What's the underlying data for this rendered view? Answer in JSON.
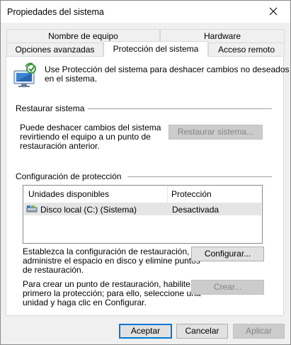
{
  "window": {
    "title": "Propiedades del sistema"
  },
  "tabs": {
    "row1": [
      "Nombre de equipo",
      "Hardware"
    ],
    "row2": [
      "Opciones avanzadas",
      "Protección del sistema",
      "Acceso remoto"
    ],
    "selected": "Protección del sistema"
  },
  "intro": {
    "line1": "Use Protección del sistema para deshacer cambios no deseados",
    "line2": "en el sistema."
  },
  "restore": {
    "group_title": "Restaurar sistema",
    "desc_line1": "Puede deshacer cambios del sistema",
    "desc_line2": "revirtiendo el equipo a un punto de",
    "desc_line3": "restauración anterior.",
    "button_label": "Restaurar sistema..."
  },
  "protection": {
    "group_title": "Configuración de protección",
    "columns": [
      "Unidades disponibles",
      "Protección"
    ],
    "drives": [
      {
        "name": "Disco local (C:) (Sistema)",
        "protection": "Desactivada"
      }
    ],
    "configure_line1": "Establezca la configuración de restauración,",
    "configure_line2": "administre el espacio en disco y elimine puntos",
    "configure_line3": "de restauración.",
    "configure_button": "Configurar...",
    "create_line1": "Para crear un punto de restauración, habilite",
    "create_line2": "primero la protección; para ello, seleccione una",
    "create_line3": "unidad y haga clic en Configurar.",
    "create_button": "Crear..."
  },
  "footer": {
    "accept": "Aceptar",
    "cancel": "Cancelar",
    "apply": "Aplicar"
  },
  "colors": {
    "accent": "#0078d7",
    "selected_row": "#e5e5e5",
    "disabled_text": "#838383"
  }
}
